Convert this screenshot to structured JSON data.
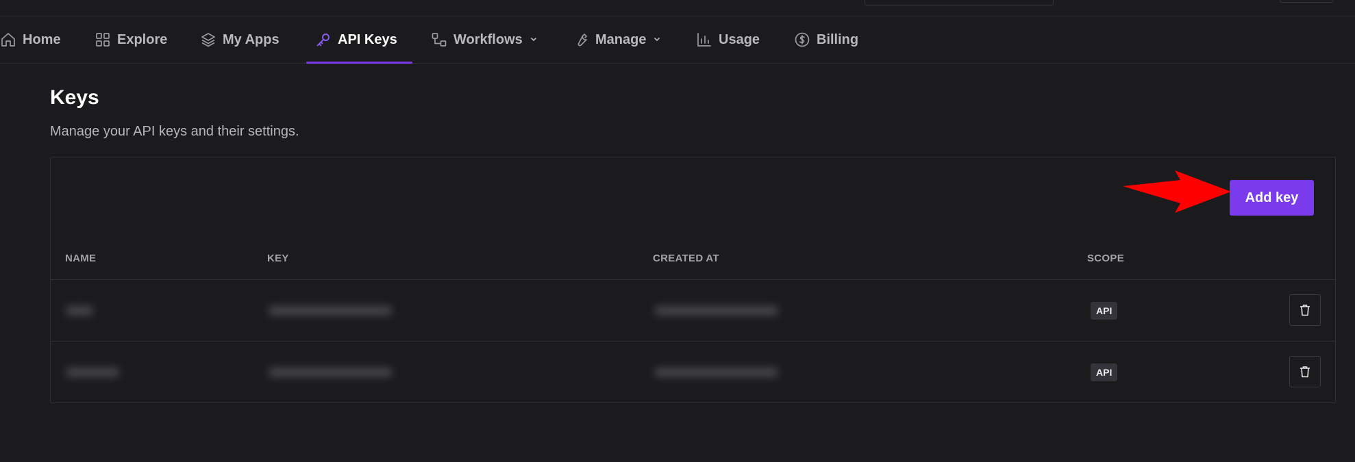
{
  "nav": {
    "items": [
      {
        "label": "Home",
        "icon": "home-icon"
      },
      {
        "label": "Explore",
        "icon": "grid-icon"
      },
      {
        "label": "My Apps",
        "icon": "layers-icon"
      },
      {
        "label": "API Keys",
        "icon": "key-icon",
        "active": true
      },
      {
        "label": "Workflows",
        "icon": "workflow-icon",
        "dropdown": true
      },
      {
        "label": "Manage",
        "icon": "wrench-icon",
        "dropdown": true
      },
      {
        "label": "Usage",
        "icon": "bar-chart-icon"
      },
      {
        "label": "Billing",
        "icon": "dollar-circle-icon"
      }
    ]
  },
  "page": {
    "title": "Keys",
    "subtitle": "Manage your API keys and their settings."
  },
  "toolbar": {
    "add_key_label": "Add key"
  },
  "table": {
    "columns": [
      "NAME",
      "KEY",
      "CREATED AT",
      "SCOPE"
    ],
    "rows": [
      {
        "name": "",
        "key": "",
        "created_at": "",
        "scope": "API"
      },
      {
        "name": "",
        "key": "",
        "created_at": "",
        "scope": "API"
      }
    ]
  },
  "colors": {
    "background": "#1b1b1d",
    "accent": "#7c3aed",
    "annotation_arrow": "#ff0000"
  }
}
